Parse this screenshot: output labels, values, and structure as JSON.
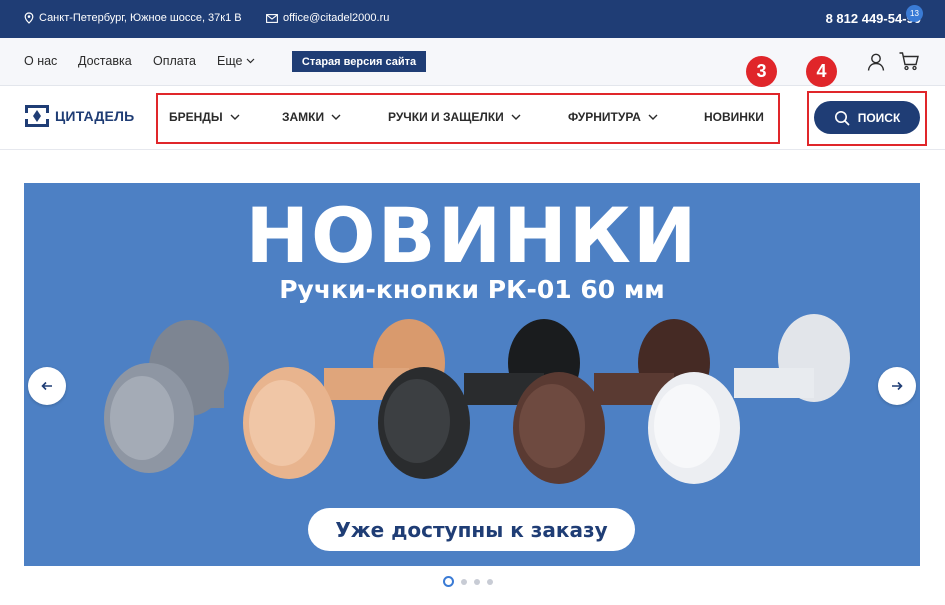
{
  "topbar": {
    "address": "Санкт-Петербург, Южное шоссе, 37к1 В",
    "email": "office@citadel2000.ru",
    "phone": "8 812 449-54-90"
  },
  "nav2": {
    "about": "О нас",
    "delivery": "Доставка",
    "payment": "Оплата",
    "more": "Еще",
    "old_version": "Старая версия сайта",
    "cart_count": "13"
  },
  "header": {
    "logo": "ЦИТАДЕЛЬ",
    "menu": [
      {
        "label": "БРЕНДЫ",
        "has_dropdown": true
      },
      {
        "label": "ЗАМКИ",
        "has_dropdown": true
      },
      {
        "label": "РУЧКИ И ЗАЩЕЛКИ",
        "has_dropdown": true
      },
      {
        "label": "ФУРНИТУРА",
        "has_dropdown": true
      },
      {
        "label": "НОВИНКИ",
        "has_dropdown": false
      }
    ],
    "search": "ПОИСК"
  },
  "annotations": {
    "menu_marker": "3",
    "search_marker": "4"
  },
  "banner": {
    "title": "НОВИНКИ",
    "subtitle": "Ручки-кнопки РК-01 60 мм",
    "cta": "Уже доступны к заказу",
    "knob_colors": [
      "#8e96a3",
      "#e8b48e",
      "#2a2c2e",
      "#5a3a32",
      "#eceef2"
    ],
    "slides": 4,
    "active_slide": 1
  },
  "colors": {
    "brand": "#1f3d75",
    "banner_bg": "#4d80c4",
    "annotation": "#e0262a"
  }
}
